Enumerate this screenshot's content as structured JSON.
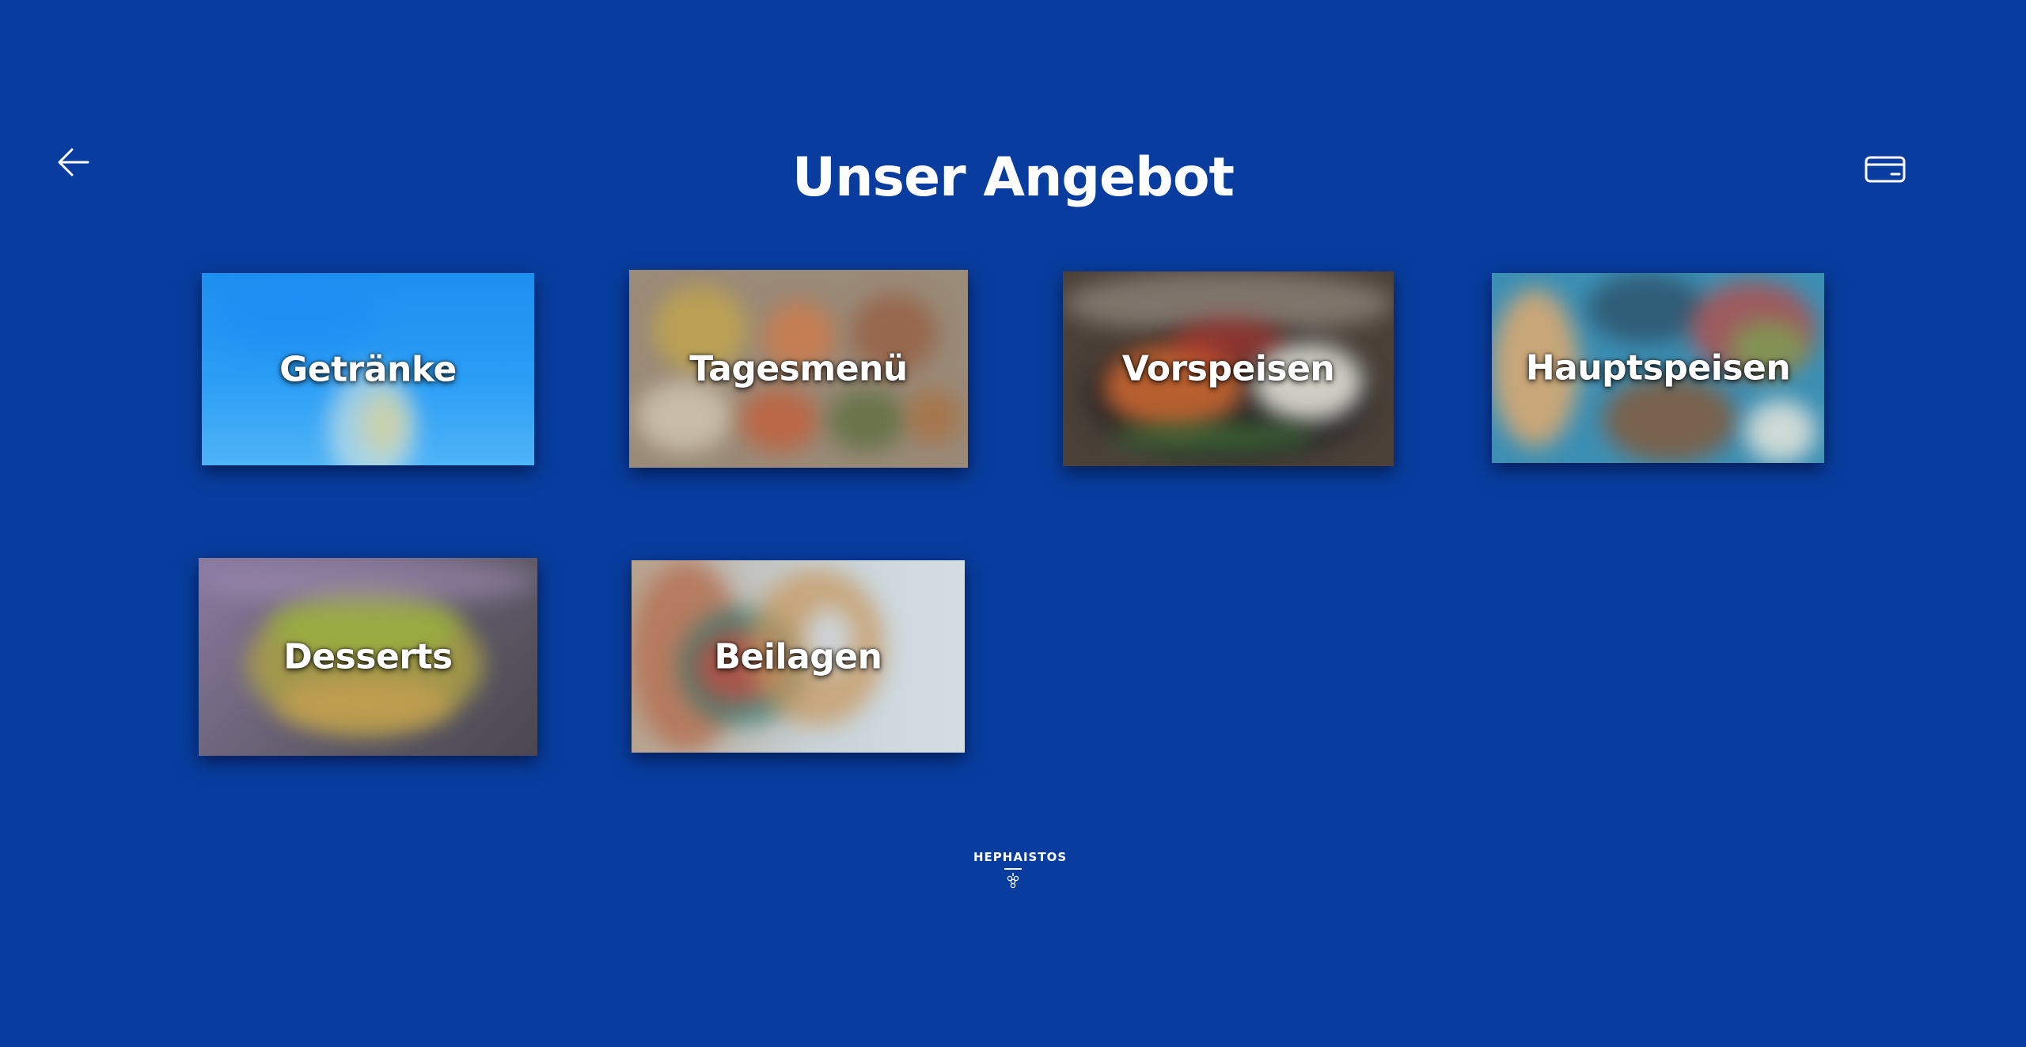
{
  "header": {
    "title": "Unser Angebot",
    "back_icon": "arrow-left-icon",
    "card_icon": "credit-card-icon"
  },
  "categories": [
    {
      "label": "Getränke"
    },
    {
      "label": "Tagesmenü"
    },
    {
      "label": "Vorspeisen"
    },
    {
      "label": "Hauptspeisen"
    },
    {
      "label": "Desserts"
    },
    {
      "label": "Beilagen"
    }
  ],
  "footer": {
    "logo_text": "HEPHAISTOS"
  },
  "colors": {
    "background": "#083d9f",
    "text": "#ffffff"
  }
}
